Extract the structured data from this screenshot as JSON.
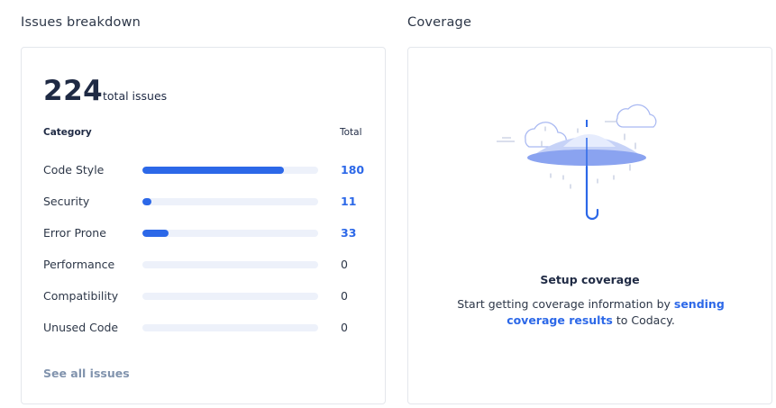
{
  "issues": {
    "title": "Issues breakdown",
    "total_number": "224",
    "total_label": "total issues",
    "column_category": "Category",
    "column_total": "Total",
    "rows": [
      {
        "label": "Code Style",
        "value": "180",
        "fraction": 0.8036
      },
      {
        "label": "Security",
        "value": "11",
        "fraction": 0.0491
      },
      {
        "label": "Error Prone",
        "value": "33",
        "fraction": 0.1473
      },
      {
        "label": "Performance",
        "value": "0",
        "fraction": 0
      },
      {
        "label": "Compatibility",
        "value": "0",
        "fraction": 0
      },
      {
        "label": "Unused Code",
        "value": "0",
        "fraction": 0
      }
    ],
    "see_all": "See all issues"
  },
  "coverage": {
    "title": "Coverage",
    "illustration_icon": "umbrella-rain-icon",
    "heading": "Setup coverage",
    "text_before": "Start getting coverage information by ",
    "link": "sending coverage results",
    "text_after": " to Codacy."
  },
  "colors": {
    "accent": "#2c68e8",
    "bar_track": "#edf1fa",
    "muted_link": "#8193ad"
  }
}
